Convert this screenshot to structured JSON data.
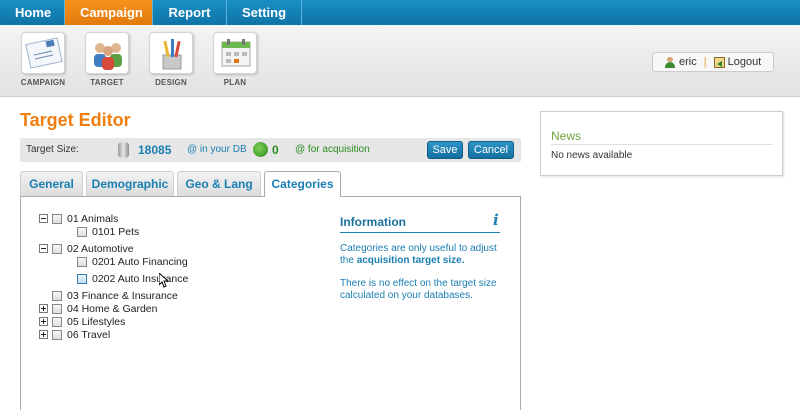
{
  "nav": {
    "home": "Home",
    "campaign": "Campaign",
    "report": "Report",
    "setting": "Setting"
  },
  "toolbar": {
    "campaign": "CAMPAIGN",
    "target": "TARGET",
    "design": "DESIGN",
    "plan": "PLAN"
  },
  "user": {
    "name": "eric",
    "logout": "Logout"
  },
  "page": {
    "title": "Target Editor"
  },
  "size": {
    "label": "Target Size:",
    "db_count": "18085",
    "db_label": "@ in your DB",
    "acq_count": "0",
    "acq_label": "@ for acquisition",
    "save": "Save",
    "cancel": "Cancel"
  },
  "tabs": {
    "general": "General",
    "demographic": "Demographic",
    "geo": "Geo & Lang",
    "categories": "Categories"
  },
  "tree": {
    "animals": "01 Animals",
    "pets": "0101 Pets",
    "automotive": "02 Automotive",
    "auto_financing": "0201 Auto Financing",
    "auto_insurance": "0202 Auto Insurance",
    "finance": "03 Finance & Insurance",
    "home_garden": "04 Home & Garden",
    "lifestyles": "05 Lifestyles",
    "travel": "06 Travel"
  },
  "info": {
    "title": "Information",
    "icon": "i",
    "p1_a": "Categories are only useful to adjust the ",
    "p1_b": "acquisition target size.",
    "p2": "There is no effect on the target size calculated on your databases."
  },
  "news": {
    "title": "News",
    "body": "No news available"
  },
  "colors": {
    "accent_orange": "#f07f0f",
    "link_blue": "#1b7fb3",
    "nav_blue": "#1a8fc4",
    "news_green": "#6fa53a"
  }
}
